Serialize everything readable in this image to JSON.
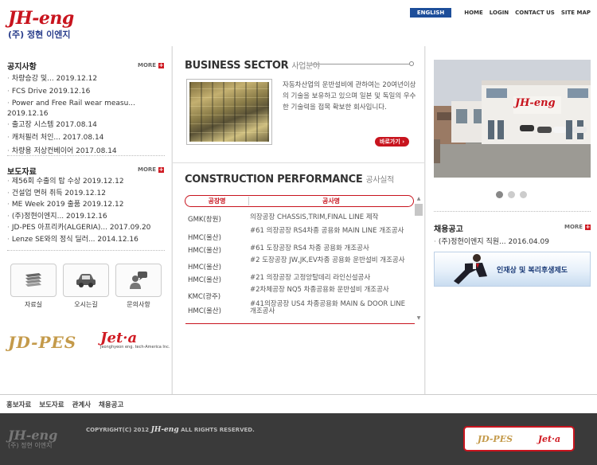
{
  "header": {
    "logo_main": "JH-eng",
    "logo_sub": "(주) 정현 이엔지",
    "nav": [
      "HOME",
      "LOGIN",
      "CONTACT US",
      "SITE MAP"
    ],
    "lang": "ENGLISH"
  },
  "notice": {
    "title": "공지사항",
    "more": "MORE",
    "items": [
      "차량승강 및... 2019.12.12",
      "FCS Drive 2019.12.16",
      "Power and Free Rail wear measu...",
      "2019.12.16",
      "출고장 시스템 2017.08.14",
      "캐처필러 처인... 2017.08.14",
      "차량용 저상컨베이어 2017.08.14"
    ]
  },
  "press": {
    "title": "보도자료",
    "more": "MORE",
    "items": [
      "제56회 수출의 탑 수상 2019.12.12",
      "건설업 면허 취득 2019.12.12",
      "ME Week 2019 출품 2019.12.12",
      "(주)정현이엔지... 2019.12.16",
      "JD-PES 아프리카(ALGERIA)... 2017.09.20",
      "Lenze SE와의 정식 딜러... 2014.12.16"
    ]
  },
  "quick": [
    {
      "label": "자료실",
      "icon": "document-stack-icon"
    },
    {
      "label": "오시는길",
      "icon": "car-icon"
    },
    {
      "label": "문의사항",
      "icon": "person-chat-icon"
    }
  ],
  "partners": {
    "jdpes": "JD-PES",
    "jeta": "Jet·a",
    "jeta_sub": "Jeonghyeon eng. tech-America Inc."
  },
  "business": {
    "title": "BUSINESS SECTOR",
    "title_kr": "사업분야",
    "text": "자동차산업의 운반설비에 관하여는 20여년이상의 기술을 보유하고 있으며 일본 및 독일의 우수한 기술력을 접목 확보한 회사입니다.",
    "button": "바로가기"
  },
  "performance": {
    "title": "CONSTRUCTION PERFORMANCE",
    "title_kr": "공사실적",
    "col1": "공장명",
    "col2": "공사명",
    "rows": [
      {
        "plant": "GMK(창원)",
        "work": "의장공장 CHASSIS,TRIM,FINAL LINE 제작"
      },
      {
        "plant": "HMC(울산)",
        "work": "#61 의장공장 RS4차종 공용화 MAIN LINE 개조공사"
      },
      {
        "plant": "HMC(울산)",
        "work": "#61 도장공장 RS4 차종 공용화 개조공사"
      },
      {
        "plant": "HMC(울산)",
        "work": "#2 도장공장 JW,JK,EV차종 공용화 운반설비 개조공사"
      },
      {
        "plant": "HMC(울산)",
        "work": "#21 의장공장 고정앙탈데리 라인신설공사"
      },
      {
        "plant": "KMC(광주)",
        "work": "#2차체공장 NQ5 차종공용화 운반설비 개조공사"
      },
      {
        "plant": "HMC(울산)",
        "work": "#41의장공장 US4 차종공용화 MAIN & DOOR LINE 개조공사"
      }
    ]
  },
  "photo": {
    "sign": "JH-eng"
  },
  "recruit": {
    "title": "채용공고",
    "more": "MORE",
    "items": [
      "(주)정현이엔지 직원... 2016.04.09"
    ],
    "banner": "인재상 및 복리후생제도"
  },
  "footer": {
    "menu": [
      "홍보자료",
      "보도자료",
      "관계사",
      "채용공고"
    ],
    "logo_main": "JH-eng",
    "logo_sub": "(주) 정현 이엔지",
    "copy_pre": "COPYRIGHT(C) 2012",
    "copy_brand": "JH-eng",
    "copy_post": "ALL RIGHTS RESERVED.",
    "banner_a": "JD-PES",
    "banner_b": "Jet·a"
  }
}
